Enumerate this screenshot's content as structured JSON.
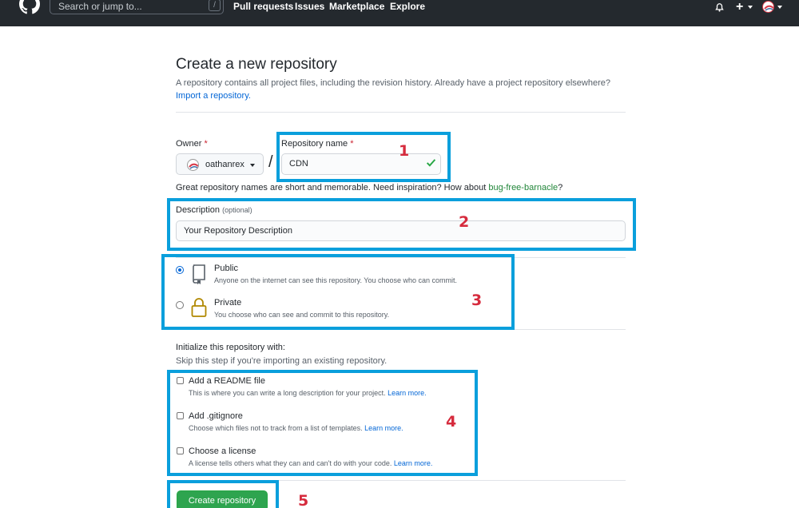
{
  "header": {
    "search_placeholder": "Search or jump to...",
    "search_shortcut": "/",
    "nav": [
      "Pull requests",
      "Issues",
      "Marketplace",
      "Explore"
    ]
  },
  "page": {
    "title": "Create a new repository",
    "subtitle_text": "A repository contains all project files, including the revision history. Already have a project repository elsewhere?",
    "import_link": "Import a repository."
  },
  "owner": {
    "label": "Owner",
    "required_mark": "*",
    "name": "oathanrex",
    "separator": "/"
  },
  "repo_name": {
    "label": "Repository name",
    "required_mark": "*",
    "value": "CDN"
  },
  "name_hint": {
    "text": "Great repository names are short and memorable. Need inspiration? How about",
    "suggestion": "bug-free-barnacle",
    "end": "?"
  },
  "description": {
    "label": "Description",
    "optional": "(optional)",
    "value": "Your Repository Description"
  },
  "visibility": {
    "public": {
      "title": "Public",
      "desc": "Anyone on the internet can see this repository. You choose who can commit.",
      "selected": true
    },
    "private": {
      "title": "Private",
      "desc": "You choose who can see and commit to this repository.",
      "selected": false
    }
  },
  "initialize": {
    "heading": "Initialize this repository with:",
    "subheading": "Skip this step if you're importing an existing repository.",
    "options": [
      {
        "title": "Add a README file",
        "desc": "This is where you can write a long description for your project.",
        "link": "Learn more."
      },
      {
        "title": "Add .gitignore",
        "desc": "Choose which files not to track from a list of templates.",
        "link": "Learn more."
      },
      {
        "title": "Choose a license",
        "desc": "A license tells others what they can and can't do with your code.",
        "link": "Learn more."
      }
    ]
  },
  "create_button": "Create repository",
  "annotations": [
    "1",
    "2",
    "3",
    "4",
    "5"
  ],
  "colors": {
    "header_bg": "#24292e",
    "annotation_box": "#0a9fdc",
    "annotation_number": "#d62b3d",
    "primary_button": "#2ea44f",
    "link": "#0366d6"
  }
}
